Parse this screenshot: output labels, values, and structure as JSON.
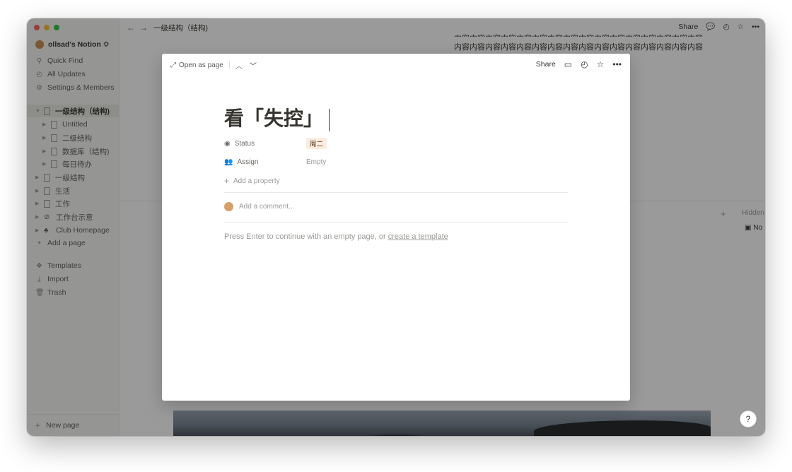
{
  "sidebar": {
    "workspace_name": "ollsad's Notion ≎",
    "top_items": [
      {
        "label": "Quick Find",
        "icon": "search-icon"
      },
      {
        "label": "All Updates",
        "icon": "clock-icon"
      },
      {
        "label": "Settings & Members",
        "icon": "gear-icon"
      }
    ],
    "pages": [
      {
        "label": "一级结构（结构)",
        "active": true
      },
      {
        "label": "Untitled"
      },
      {
        "label": "二级结构"
      },
      {
        "label": "数据库（结构)"
      },
      {
        "label": "每日待办"
      },
      {
        "label": "一级结构"
      },
      {
        "label": "生活"
      },
      {
        "label": "工作"
      },
      {
        "label": "工作台示意"
      },
      {
        "label": "Club Homepage"
      }
    ],
    "add_page": "Add a page",
    "bottom_items": [
      {
        "label": "Templates"
      },
      {
        "label": "Import"
      },
      {
        "label": "Trash"
      }
    ],
    "new_page": "New page"
  },
  "topbar": {
    "breadcrumb": "一级结构（结构)",
    "share": "Share"
  },
  "background": {
    "content_text": "内容内容内容内容内容内容内容内容内容内容内容内容内容内容内容内容",
    "hidden_label": "Hidden",
    "no_label": "No",
    "help": "?"
  },
  "modal": {
    "open_as_page": "Open as page",
    "share": "Share",
    "title": "看「失控」",
    "properties": [
      {
        "name": "Status",
        "value": "周二"
      },
      {
        "name": "Assign",
        "value": "Empty"
      }
    ],
    "add_property": "Add a property",
    "comment_placeholder": "Add a comment...",
    "hint_prefix": "Press Enter to continue with an empty page, or ",
    "hint_link": "create a template"
  },
  "colors": {
    "tag_bg": "#fbecdd",
    "tag_text": "#49290e",
    "traffic_red": "#ff5f57",
    "traffic_yellow": "#febc2e",
    "traffic_green": "#28c840"
  }
}
